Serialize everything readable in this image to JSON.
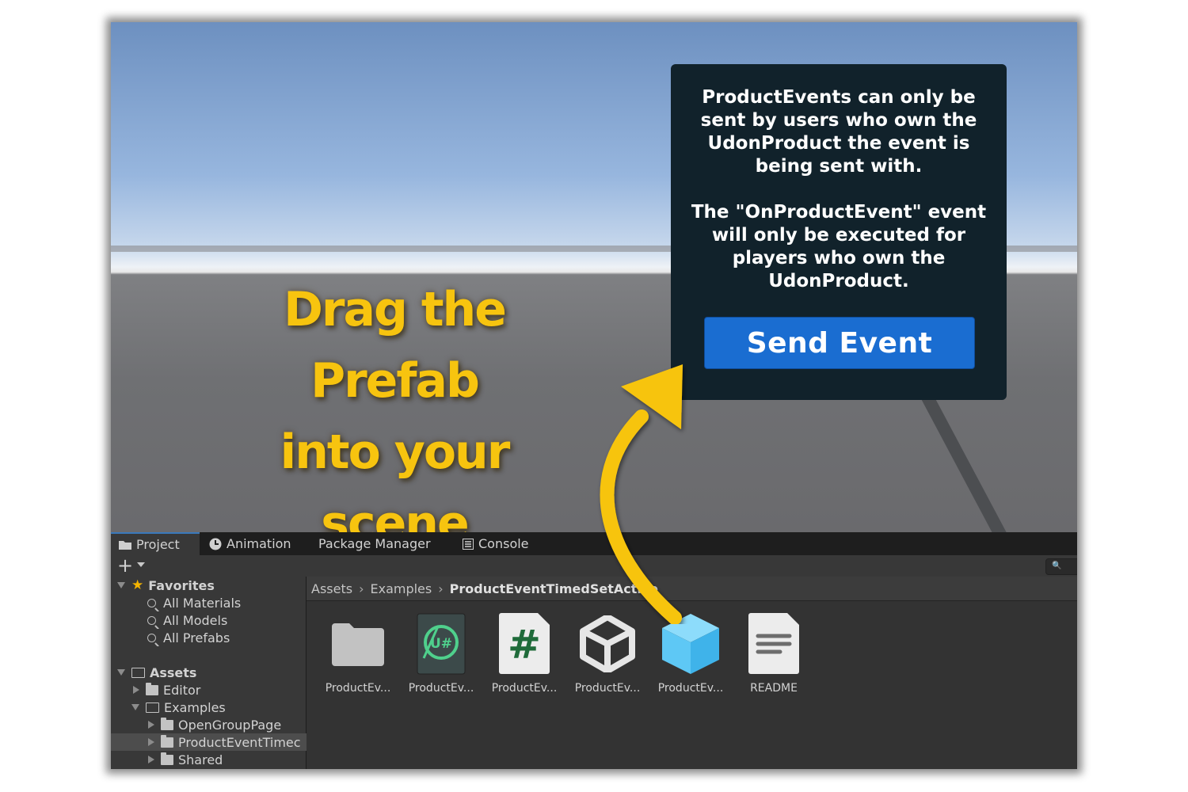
{
  "scene": {
    "info_paragraph_1": "ProductEvents can only be\nsent by users who own the\nUdonProduct the event is\nbeing sent with.",
    "info_paragraph_2": "The \"OnProductEvent\" event\nwill only be executed for\nplayers who own the\nUdonProduct.",
    "send_button_label": "Send Event"
  },
  "callout": {
    "line1": "Drag the Prefab",
    "line2": "into your scene",
    "color": "#f7c40f"
  },
  "tabs": [
    {
      "label": "Project",
      "icon": "folder-icon",
      "active": true
    },
    {
      "label": "Animation",
      "icon": "clock-icon",
      "active": false
    },
    {
      "label": "Package Manager",
      "icon": "",
      "active": false
    },
    {
      "label": "Console",
      "icon": "console-icon",
      "active": false
    }
  ],
  "toolbar": {
    "create_label": "+"
  },
  "tree": {
    "favorites_label": "Favorites",
    "favorites_items": [
      "All Materials",
      "All Models",
      "All Prefabs"
    ],
    "assets_label": "Assets",
    "editor_label": "Editor",
    "examples_label": "Examples",
    "examples_children": [
      "OpenGroupPage",
      "ProductEventTimec",
      "Shared"
    ]
  },
  "breadcrumb": {
    "root": "Assets",
    "middle": "Examples",
    "current": "ProductEventTimedSetActive"
  },
  "assets": [
    {
      "label": "ProductEv...",
      "icon": "folder-icon"
    },
    {
      "label": "ProductEv...",
      "icon": "udonsharp-program-icon"
    },
    {
      "label": "ProductEv...",
      "icon": "csharp-script-icon"
    },
    {
      "label": "ProductEv...",
      "icon": "unity-scene-icon"
    },
    {
      "label": "ProductEv...",
      "icon": "prefab-icon"
    },
    {
      "label": "README",
      "icon": "text-document-icon"
    }
  ],
  "colors": {
    "accent_blue": "#1a6dd1",
    "panel_dark": "#11222b",
    "arrow_yellow": "#f7c40f",
    "prefab_blue": "#5ec8f5"
  }
}
